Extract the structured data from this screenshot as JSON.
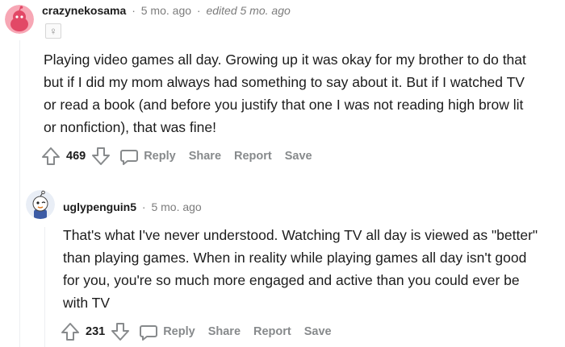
{
  "comments": [
    {
      "username": "crazynekosama",
      "separator": "·",
      "time": "5 mo. ago",
      "edited": "edited 5 mo. ago",
      "flair": "♀",
      "text": "Playing video games all day. Growing up it was okay for my brother to do that but if I did my mom always had something to say about it. But if I watched TV or read a book (and before you justify that one I was not reading high brow lit or nonfiction), that was fine!",
      "votes": "469",
      "reply": "Reply",
      "share": "Share",
      "report": "Report",
      "save": "Save"
    },
    {
      "username": "uglypenguin5",
      "separator": "·",
      "time": "5 mo. ago",
      "text": "That's what I've never understood. Watching TV all day is viewed as \"better\" than playing games. When in reality while playing games all day isn't good for you, you're so much more engaged and active than you could ever be with TV",
      "votes": "231",
      "reply": "Reply",
      "share": "Share",
      "report": "Report",
      "save": "Save"
    }
  ],
  "colors": {
    "avatar1_bg": "#f7a7b5",
    "avatar2_bg": "#e9eef6",
    "muted": "#878a8c",
    "thread_line": "#edeff1"
  }
}
